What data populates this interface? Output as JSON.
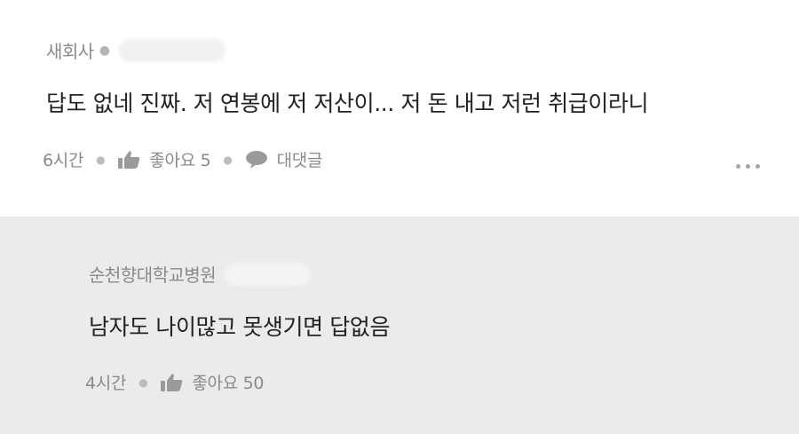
{
  "comments": [
    {
      "author": "새회사",
      "body": "답도 없네 진짜. 저 연봉에 저 저산이... 저 돈 내고 저런 취급이라니",
      "time": "6시간",
      "like_label": "좋아요 5",
      "reply_label": "대댓글"
    },
    {
      "author": "순천향대학교병원",
      "body": "남자도 나이많고 못생기면 답없음",
      "time": "4시간",
      "like_label": "좋아요 50"
    }
  ],
  "icons": {
    "like": "thumbs-up-icon",
    "reply": "speech-bubble-icon",
    "more": "more-dots-icon"
  },
  "colors": {
    "reply_background": "#ebebec",
    "meta_text": "#8a8a8a",
    "body_text": "#222222"
  }
}
